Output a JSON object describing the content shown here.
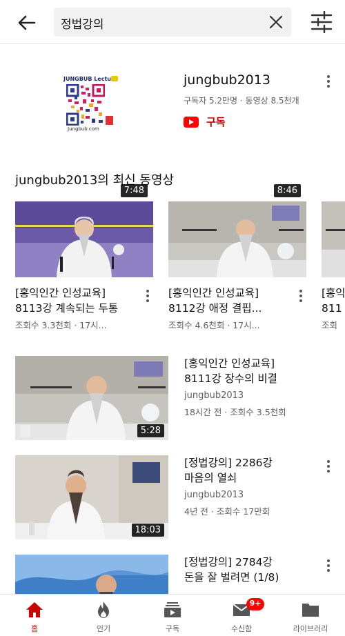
{
  "search": {
    "query": "정법강의"
  },
  "channel": {
    "name": "jungbub2013",
    "stats": "구독자 5.2만명 · 동영상 8.5천개",
    "subscribe_label": "구독",
    "logo_top": "JUNGBUB Lecture",
    "logo_url": "Jungbub.com"
  },
  "section_title": "jungbub2013의 최신 동영상",
  "shelf": [
    {
      "title1": "[홍익인간 인성교육]",
      "title2": "8113강 계속되는 두통",
      "meta": "조회수 3.3천회 · 17시...",
      "duration": "7:48"
    },
    {
      "title1": "[홍익인간 인성교육]",
      "title2": "8112강 애정 결핍...",
      "meta": "조회수 4.6천회 · 17시...",
      "duration": "8:46"
    },
    {
      "title1": "[홍익",
      "title2": "811",
      "meta": "조회"
    }
  ],
  "videos": [
    {
      "title1": "[홍익인간 인성교육]",
      "title2": "8111강 장수의 비결",
      "channel": "jungbub2013",
      "meta": "18시간 전 · 조회수 3.5천회",
      "duration": "5:28"
    },
    {
      "title1": "[정법강의] 2286강",
      "title2": "마음의 열쇠",
      "channel": "jungbub2013",
      "meta": "4년 전 · 조회수 17만회",
      "duration": "18:03"
    },
    {
      "title1": "[정법강의] 2784강",
      "title2": "돈을 잘 벌려면 (1/8)",
      "channel": "",
      "meta": "",
      "duration": ""
    }
  ],
  "nav": [
    {
      "label": "홈",
      "icon": "home-icon"
    },
    {
      "label": "인기",
      "icon": "fire-icon"
    },
    {
      "label": "구독",
      "icon": "subscriptions-icon"
    },
    {
      "label": "수신함",
      "icon": "inbox-icon",
      "badge": "9+"
    },
    {
      "label": "라이브러리",
      "icon": "library-icon"
    }
  ]
}
